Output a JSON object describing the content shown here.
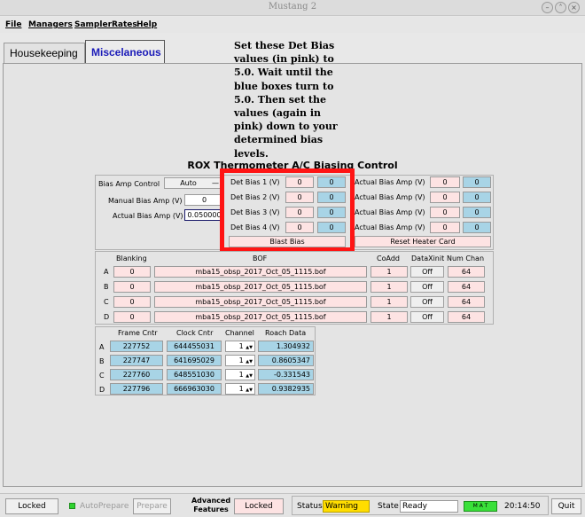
{
  "window": {
    "title": "Mustang 2"
  },
  "menu": [
    "File",
    "Managers",
    "SamplerRates",
    "Help"
  ],
  "tabs": {
    "housekeeping": "Housekeeping",
    "miscelaneous": "Miscelaneous"
  },
  "annotation": [
    "Set these Det Bias",
    "values (in pink) to",
    "5.0. Wait until the",
    "blue boxes turn to",
    "5.0. Then set the",
    "values (again in",
    "pink) down to your",
    "determined bias",
    "levels."
  ],
  "rox": {
    "title": "ROX Thermometer A/C Biasing Control",
    "bias_amp_control_label": "Bias Amp Control",
    "bias_amp_control_value": "Auto",
    "manual_bias_amp_label": "Manual Bias Amp (V)",
    "manual_bias_amp_value": "0",
    "actual_bias_amp_label": "Actual Bias Amp (V)",
    "actual_bias_amp_value": "0.050000",
    "det_bias": [
      {
        "label": "Det Bias 1 (V)",
        "set": "0",
        "actual": "0"
      },
      {
        "label": "Det Bias 2 (V)",
        "set": "0",
        "actual": "0"
      },
      {
        "label": "Det Bias 3 (V)",
        "set": "0",
        "actual": "0"
      },
      {
        "label": "Det Bias 4 (V)",
        "set": "0",
        "actual": "0"
      }
    ],
    "actual_amp": [
      {
        "label": "Actual Bias Amp (V)",
        "set": "0",
        "actual": "0"
      },
      {
        "label": "Actual Bias Amp (V)",
        "set": "0",
        "actual": "0"
      },
      {
        "label": "Actual Bias Amp (V)",
        "set": "0",
        "actual": "0"
      },
      {
        "label": "Actual Bias Amp (V)",
        "set": "0",
        "actual": "0"
      }
    ],
    "blast_bias": "Blast Bias",
    "reset_heater": "Reset Heater Card"
  },
  "bof": {
    "headers": {
      "blanking": "Blanking",
      "bof": "BOF",
      "coadd": "CoAdd",
      "dataxinit": "DataXinit",
      "numchan": "Num Chan"
    },
    "rows": [
      {
        "id": "A",
        "blanking": "0",
        "bof": "mba15_obsp_2017_Oct_05_1115.bof",
        "coadd": "1",
        "dataxinit": "Off",
        "numchan": "64"
      },
      {
        "id": "B",
        "blanking": "0",
        "bof": "mba15_obsp_2017_Oct_05_1115.bof",
        "coadd": "1",
        "dataxinit": "Off",
        "numchan": "64"
      },
      {
        "id": "C",
        "blanking": "0",
        "bof": "mba15_obsp_2017_Oct_05_1115.bof",
        "coadd": "1",
        "dataxinit": "Off",
        "numchan": "64"
      },
      {
        "id": "D",
        "blanking": "0",
        "bof": "mba15_obsp_2017_Oct_05_1115.bof",
        "coadd": "1",
        "dataxinit": "Off",
        "numchan": "64"
      }
    ]
  },
  "counters": {
    "headers": {
      "frame": "Frame Cntr",
      "clock": "Clock Cntr",
      "channel": "Channel",
      "roach": "Roach Data"
    },
    "rows": [
      {
        "id": "A",
        "frame": "227752",
        "clock": "644455031",
        "channel": "1",
        "roach": "1.304932"
      },
      {
        "id": "B",
        "frame": "227747",
        "clock": "641695029",
        "channel": "1",
        "roach": "0.8605347"
      },
      {
        "id": "C",
        "frame": "227760",
        "clock": "648551030",
        "channel": "1",
        "roach": "-0.331543"
      },
      {
        "id": "D",
        "frame": "227796",
        "clock": "666963030",
        "channel": "1",
        "roach": "0.9382935"
      }
    ]
  },
  "status": {
    "locked_button": "Locked",
    "autoprepare": "AutoPrepare",
    "prepare": "Prepare",
    "advanced_line1": "Advanced",
    "advanced_line2": "Features",
    "advanced_locked": "Locked",
    "status_label": "Status",
    "status_value": "Warning",
    "state_label": "State",
    "state_value": "Ready",
    "indicators": [
      "M",
      "A",
      "T"
    ],
    "time": "20:14:50",
    "quit": "Quit",
    "colors": {
      "warning": "#ffdd00",
      "indicator": "#39e039",
      "autoprepare_led": "#2fd22f"
    }
  }
}
